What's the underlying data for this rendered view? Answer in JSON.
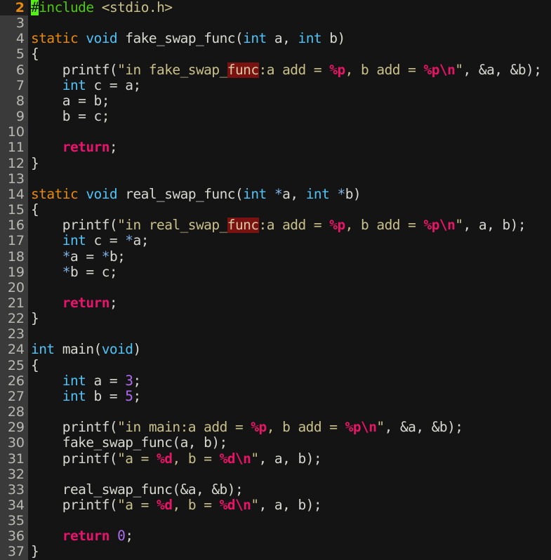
{
  "editor": {
    "background": "#141414",
    "gutter_background": "#3a3a3a",
    "gutter_current_background": "#1d1d1d",
    "gutter_text_color": "#b9b9b3",
    "gutter_current_text_color": "#e8890c",
    "cursor_color": "#54f014",
    "search_highlight_color": "#7a1212",
    "first_visible_line": 2,
    "cursor_line": 2,
    "cursor_column": 1,
    "cursor_char": "#",
    "search_term": "func"
  },
  "colors": {
    "keyword": "#e8890c",
    "type": "#4fc3f7",
    "preprocessor": "#4fc80f",
    "string": "#c9c08a",
    "format_specifier": "#e8146c",
    "number": "#b06cf0",
    "return_keyword": "#e8146c",
    "plain": "#d8d8d2"
  },
  "lines": [
    {
      "number": "2",
      "current": true,
      "tokens": [
        {
          "text": "#",
          "cls": "cursor"
        },
        {
          "text": "include",
          "cls": "t-preproc"
        },
        {
          "text": " ",
          "cls": "t-plain"
        },
        {
          "text": "<stdio.h>",
          "cls": "t-header"
        }
      ]
    },
    {
      "number": "3",
      "current": false,
      "tokens": []
    },
    {
      "number": "4",
      "current": false,
      "tokens": [
        {
          "text": "static",
          "cls": "t-kw"
        },
        {
          "text": " ",
          "cls": "t-plain"
        },
        {
          "text": "void",
          "cls": "t-type"
        },
        {
          "text": " fake_swap_func(",
          "cls": "t-plain"
        },
        {
          "text": "int",
          "cls": "t-type"
        },
        {
          "text": " a, ",
          "cls": "t-plain"
        },
        {
          "text": "int",
          "cls": "t-type"
        },
        {
          "text": " b)",
          "cls": "t-plain"
        }
      ]
    },
    {
      "number": "5",
      "current": false,
      "tokens": [
        {
          "text": "{",
          "cls": "t-plain"
        }
      ]
    },
    {
      "number": "6",
      "current": false,
      "tokens": [
        {
          "text": "    printf(",
          "cls": "t-plain"
        },
        {
          "text": "\"in fake_swap_",
          "cls": "t-string"
        },
        {
          "text": "func",
          "cls": "search-hit"
        },
        {
          "text": ":a add = ",
          "cls": "t-string"
        },
        {
          "text": "%p",
          "cls": "t-fmt"
        },
        {
          "text": ", b add = ",
          "cls": "t-string"
        },
        {
          "text": "%p\\n",
          "cls": "t-fmt"
        },
        {
          "text": "\"",
          "cls": "t-string"
        },
        {
          "text": ", &a, &b);",
          "cls": "t-plain"
        }
      ]
    },
    {
      "number": "7",
      "current": false,
      "tokens": [
        {
          "text": "    ",
          "cls": "t-plain"
        },
        {
          "text": "int",
          "cls": "t-type"
        },
        {
          "text": " c = a;",
          "cls": "t-plain"
        }
      ]
    },
    {
      "number": "8",
      "current": false,
      "tokens": [
        {
          "text": "    a = b;",
          "cls": "t-plain"
        }
      ]
    },
    {
      "number": "9",
      "current": false,
      "tokens": [
        {
          "text": "    b = c;",
          "cls": "t-plain"
        }
      ]
    },
    {
      "number": "10",
      "current": false,
      "tokens": []
    },
    {
      "number": "11",
      "current": false,
      "tokens": [
        {
          "text": "    ",
          "cls": "t-plain"
        },
        {
          "text": "return",
          "cls": "t-return"
        },
        {
          "text": ";",
          "cls": "t-plain"
        }
      ]
    },
    {
      "number": "12",
      "current": false,
      "tokens": [
        {
          "text": "}",
          "cls": "t-plain"
        }
      ]
    },
    {
      "number": "13",
      "current": false,
      "tokens": []
    },
    {
      "number": "14",
      "current": false,
      "tokens": [
        {
          "text": "static",
          "cls": "t-kw"
        },
        {
          "text": " ",
          "cls": "t-plain"
        },
        {
          "text": "void",
          "cls": "t-type"
        },
        {
          "text": " real_swap_func(",
          "cls": "t-plain"
        },
        {
          "text": "int",
          "cls": "t-type"
        },
        {
          "text": " ",
          "cls": "t-plain"
        },
        {
          "text": "*",
          "cls": "t-star"
        },
        {
          "text": "a, ",
          "cls": "t-plain"
        },
        {
          "text": "int",
          "cls": "t-type"
        },
        {
          "text": " ",
          "cls": "t-plain"
        },
        {
          "text": "*",
          "cls": "t-star"
        },
        {
          "text": "b)",
          "cls": "t-plain"
        }
      ]
    },
    {
      "number": "15",
      "current": false,
      "tokens": [
        {
          "text": "{",
          "cls": "t-plain"
        }
      ]
    },
    {
      "number": "16",
      "current": false,
      "tokens": [
        {
          "text": "    printf(",
          "cls": "t-plain"
        },
        {
          "text": "\"in real_swap_",
          "cls": "t-string"
        },
        {
          "text": "func",
          "cls": "search-hit"
        },
        {
          "text": ":a add = ",
          "cls": "t-string"
        },
        {
          "text": "%p",
          "cls": "t-fmt"
        },
        {
          "text": ", b add = ",
          "cls": "t-string"
        },
        {
          "text": "%p\\n",
          "cls": "t-fmt"
        },
        {
          "text": "\"",
          "cls": "t-string"
        },
        {
          "text": ", a, b);",
          "cls": "t-plain"
        }
      ]
    },
    {
      "number": "17",
      "current": false,
      "tokens": [
        {
          "text": "    ",
          "cls": "t-plain"
        },
        {
          "text": "int",
          "cls": "t-type"
        },
        {
          "text": " c = ",
          "cls": "t-plain"
        },
        {
          "text": "*",
          "cls": "t-star"
        },
        {
          "text": "a;",
          "cls": "t-plain"
        }
      ]
    },
    {
      "number": "18",
      "current": false,
      "tokens": [
        {
          "text": "    ",
          "cls": "t-plain"
        },
        {
          "text": "*",
          "cls": "t-star"
        },
        {
          "text": "a = ",
          "cls": "t-plain"
        },
        {
          "text": "*",
          "cls": "t-star"
        },
        {
          "text": "b;",
          "cls": "t-plain"
        }
      ]
    },
    {
      "number": "19",
      "current": false,
      "tokens": [
        {
          "text": "    ",
          "cls": "t-plain"
        },
        {
          "text": "*",
          "cls": "t-star"
        },
        {
          "text": "b = c;",
          "cls": "t-plain"
        }
      ]
    },
    {
      "number": "20",
      "current": false,
      "tokens": []
    },
    {
      "number": "21",
      "current": false,
      "tokens": [
        {
          "text": "    ",
          "cls": "t-plain"
        },
        {
          "text": "return",
          "cls": "t-return"
        },
        {
          "text": ";",
          "cls": "t-plain"
        }
      ]
    },
    {
      "number": "22",
      "current": false,
      "tokens": [
        {
          "text": "}",
          "cls": "t-plain"
        }
      ]
    },
    {
      "number": "23",
      "current": false,
      "tokens": []
    },
    {
      "number": "24",
      "current": false,
      "tokens": [
        {
          "text": "int",
          "cls": "t-type"
        },
        {
          "text": " main(",
          "cls": "t-plain"
        },
        {
          "text": "void",
          "cls": "t-type"
        },
        {
          "text": ")",
          "cls": "t-plain"
        }
      ]
    },
    {
      "number": "25",
      "current": false,
      "tokens": [
        {
          "text": "{",
          "cls": "t-plain"
        }
      ]
    },
    {
      "number": "26",
      "current": false,
      "tokens": [
        {
          "text": "    ",
          "cls": "t-plain"
        },
        {
          "text": "int",
          "cls": "t-type"
        },
        {
          "text": " a = ",
          "cls": "t-plain"
        },
        {
          "text": "3",
          "cls": "t-num"
        },
        {
          "text": ";",
          "cls": "t-plain"
        }
      ]
    },
    {
      "number": "27",
      "current": false,
      "tokens": [
        {
          "text": "    ",
          "cls": "t-plain"
        },
        {
          "text": "int",
          "cls": "t-type"
        },
        {
          "text": " b = ",
          "cls": "t-plain"
        },
        {
          "text": "5",
          "cls": "t-num"
        },
        {
          "text": ";",
          "cls": "t-plain"
        }
      ]
    },
    {
      "number": "28",
      "current": false,
      "tokens": []
    },
    {
      "number": "29",
      "current": false,
      "tokens": [
        {
          "text": "    printf(",
          "cls": "t-plain"
        },
        {
          "text": "\"in main:a add = ",
          "cls": "t-string"
        },
        {
          "text": "%p",
          "cls": "t-fmt"
        },
        {
          "text": ", b add = ",
          "cls": "t-string"
        },
        {
          "text": "%p\\n",
          "cls": "t-fmt"
        },
        {
          "text": "\"",
          "cls": "t-string"
        },
        {
          "text": ", &a, &b);",
          "cls": "t-plain"
        }
      ]
    },
    {
      "number": "30",
      "current": false,
      "tokens": [
        {
          "text": "    fake_swap_func(a, b);",
          "cls": "t-plain"
        }
      ]
    },
    {
      "number": "31",
      "current": false,
      "tokens": [
        {
          "text": "    printf(",
          "cls": "t-plain"
        },
        {
          "text": "\"a = ",
          "cls": "t-string"
        },
        {
          "text": "%d",
          "cls": "t-fmt"
        },
        {
          "text": ", b = ",
          "cls": "t-string"
        },
        {
          "text": "%d\\n",
          "cls": "t-fmt"
        },
        {
          "text": "\"",
          "cls": "t-string"
        },
        {
          "text": ", a, b);",
          "cls": "t-plain"
        }
      ]
    },
    {
      "number": "32",
      "current": false,
      "tokens": []
    },
    {
      "number": "33",
      "current": false,
      "tokens": [
        {
          "text": "    real_swap_func(&a, &b);",
          "cls": "t-plain"
        }
      ]
    },
    {
      "number": "34",
      "current": false,
      "tokens": [
        {
          "text": "    printf(",
          "cls": "t-plain"
        },
        {
          "text": "\"a = ",
          "cls": "t-string"
        },
        {
          "text": "%d",
          "cls": "t-fmt"
        },
        {
          "text": ", b = ",
          "cls": "t-string"
        },
        {
          "text": "%d\\n",
          "cls": "t-fmt"
        },
        {
          "text": "\"",
          "cls": "t-string"
        },
        {
          "text": ", a, b);",
          "cls": "t-plain"
        }
      ]
    },
    {
      "number": "35",
      "current": false,
      "tokens": []
    },
    {
      "number": "36",
      "current": false,
      "tokens": [
        {
          "text": "    ",
          "cls": "t-plain"
        },
        {
          "text": "return",
          "cls": "t-return"
        },
        {
          "text": " ",
          "cls": "t-plain"
        },
        {
          "text": "0",
          "cls": "t-num"
        },
        {
          "text": ";",
          "cls": "t-plain"
        }
      ]
    },
    {
      "number": "37",
      "current": false,
      "tokens": [
        {
          "text": "}",
          "cls": "t-plain"
        }
      ]
    }
  ]
}
